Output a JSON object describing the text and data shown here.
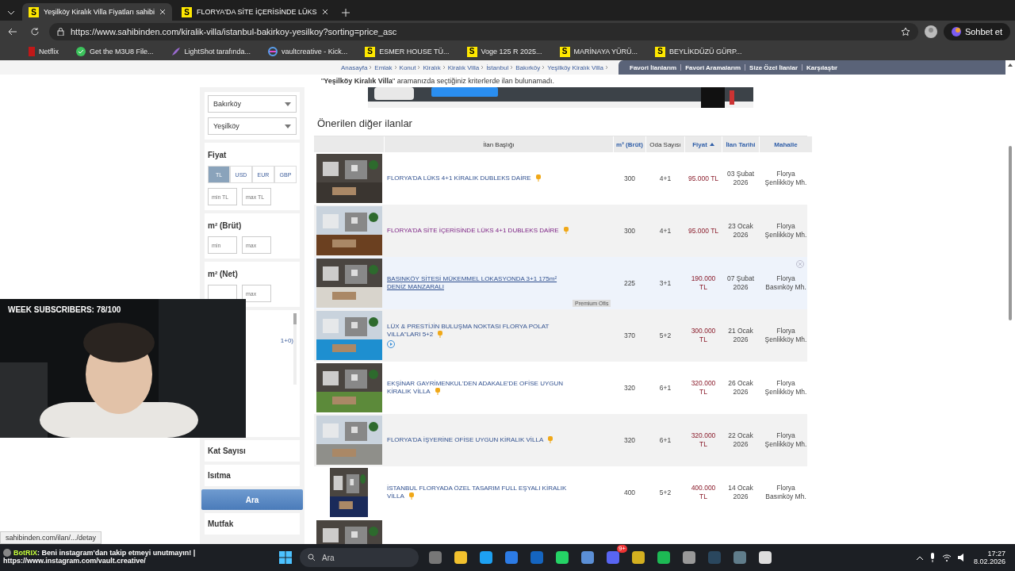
{
  "browser": {
    "tabs": [
      {
        "title": "Yeşilköy Kiralık Villa Fiyatları sahibi",
        "badge": "S",
        "selected": true
      },
      {
        "title": "FLORYA'DA SİTE İÇERİSİNDE LÜKS",
        "badge": "S",
        "selected": false
      }
    ],
    "url": "https://www.sahibinden.com/kiralik-villa/istanbul-bakirkoy-yesilkoy?sorting=price_asc",
    "bookmarks": [
      {
        "kind": "ribbon",
        "label": "Netflix"
      },
      {
        "kind": "check",
        "label": "Get the M3U8 File..."
      },
      {
        "kind": "feather",
        "label": "LightShot tarafında..."
      },
      {
        "kind": "swirl",
        "label": "vaultcreative - Kick..."
      },
      {
        "kind": "badge",
        "badge": "S",
        "label": "ESMER HOUSE TÜ..."
      },
      {
        "kind": "badge",
        "badge": "S",
        "label": "Voge 125 R 2025..."
      },
      {
        "kind": "badge",
        "badge": "S",
        "label": "MARİNAYA YÜRÜ..."
      },
      {
        "kind": "badge",
        "badge": "S",
        "label": "BEYLİKDÜZÜ GÜRP..."
      }
    ],
    "chat_button": "Sohbet et"
  },
  "page": {
    "breadcrumb": [
      "Anasayfa",
      "Emlak",
      "Konut",
      "Kiralık",
      "Kiralık Villa",
      "İstanbul",
      "Bakırköy",
      "Yeşilköy Kiralık Villa"
    ],
    "user_links": [
      "Favori İlanlarım",
      "Favori Aramalarım",
      "Size Özel İlanlar",
      "Karşılaştır"
    ],
    "notice": "\"**Yeşilköy Kiralık Villa**\" aramanızda seçtiğiniz kriterlerde ilan bulunamadı.",
    "sidebar": {
      "selects": [
        "Bakırköy",
        "Yeşilköy"
      ],
      "price": {
        "title": "Fiyat",
        "currencies": [
          {
            "label": "TL",
            "selected": true
          },
          {
            "label": "USD",
            "selected": false
          },
          {
            "label": "EUR",
            "selected": false
          },
          {
            "label": "GBP",
            "selected": false
          }
        ],
        "min_placeholder": "min TL",
        "max_placeholder": "max TL"
      },
      "gross_area": {
        "title": "m² (Brüt)",
        "min_placeholder": "min",
        "max_placeholder": "max"
      },
      "net_area": {
        "title": "m² (Net)",
        "max_placeholder": "max"
      },
      "room_option": "1+0)",
      "sections": [
        "Kat Sayısı",
        "Isıtma"
      ],
      "search_button": "Ara",
      "next_section": "Mutfak"
    },
    "suggested": {
      "title": "Önerilen diğer ilanlar",
      "columns": [
        {
          "label": "İlan Başlığı",
          "kind": "plain",
          "sorted": false
        },
        {
          "label": "m² (Brüt)",
          "kind": "link",
          "sorted": false
        },
        {
          "label": "Oda Sayısı",
          "kind": "plain",
          "sorted": false
        },
        {
          "label": "Fiyat",
          "kind": "link",
          "sorted": true
        },
        {
          "label": "İlan Tarihi",
          "kind": "link",
          "sorted": false
        },
        {
          "label": "Mahalle",
          "kind": "link",
          "sorted": false
        }
      ],
      "rows": [
        {
          "title": "FLORYA'DA LÜKS 4+1 KİRALIK DUBLEKS DAİRE",
          "visited": false,
          "hovered": false,
          "featured": true,
          "video": false,
          "area": "300",
          "rooms": "4+1",
          "price": "95.000 TL",
          "date": "03 Şubat 2026",
          "neighborhood": "Florya Şenlikköy Mh."
        },
        {
          "title": "FLORYA'DA SİTE İÇERİSİNDE LÜKS 4+1 DUBLEKS DAİRE",
          "visited": true,
          "hovered": false,
          "featured": true,
          "video": false,
          "area": "300",
          "rooms": "4+1",
          "price": "95.000 TL",
          "date": "23 Ocak 2026",
          "neighborhood": "Florya Şenlikköy Mh."
        },
        {
          "title": "BASINKÖY SİTESİ MÜKEMMEL LOKASYONDA 3+1 175m² DENİZ MANZARALI",
          "visited": false,
          "hovered": true,
          "featured": false,
          "video": false,
          "premium_label": "Premium Ofis",
          "area": "225",
          "rooms": "3+1",
          "price": "190.000 TL",
          "date": "07 Şubat 2026",
          "neighborhood": "Florya Basınköy Mh."
        },
        {
          "title": "LÜX & PRESTİJİN BULUŞMA NOKTASI FLORYA POLAT VILLA\"LARI 5+2",
          "visited": false,
          "hovered": false,
          "featured": true,
          "video": true,
          "area": "370",
          "rooms": "5+2",
          "price": "300.000 TL",
          "date": "21 Ocak 2026",
          "neighborhood": "Florya Şenlikköy Mh."
        },
        {
          "title": "EKŞİNAR GAYRİMENKUL'DEN ADAKALE'DE OFİSE UYGUN KİRALIK VİLLA",
          "visited": false,
          "hovered": false,
          "featured": true,
          "video": false,
          "area": "320",
          "rooms": "6+1",
          "price": "320.000 TL",
          "date": "26 Ocak 2026",
          "neighborhood": "Florya Şenlikköy Mh."
        },
        {
          "title": "FLORYA'DA İŞYERİNE OFİSE UYGUN KİRALIK VİLLA",
          "visited": false,
          "hovered": false,
          "featured": true,
          "video": false,
          "area": "320",
          "rooms": "6+1",
          "price": "320.000 TL",
          "date": "22 Ocak 2026",
          "neighborhood": "Florya Şenlikköy Mh."
        },
        {
          "title": "İSTANBUL FLORYADA ÖZEL TASARIM FULL EŞYALI KİRALIK VİLLA",
          "visited": false,
          "hovered": false,
          "featured": true,
          "video": false,
          "area": "400",
          "rooms": "5+2",
          "price": "400.000 TL",
          "date": "14 Ocak 2026",
          "neighborhood": "Florya Basınköy Mh."
        }
      ]
    }
  },
  "webcam": {
    "counter": "WEEK SUBSCRIBERS: 78/100"
  },
  "status_link": "sahibinden.com/ilan/.../detay",
  "chat": {
    "user": "BotRIX",
    "message": ": Beni instagram'dan takip etmeyi unutmayın! |",
    "link": "https://www.instagram.com/vault.creative/"
  },
  "taskbar": {
    "search_placeholder": "Ara",
    "notification_badge": "9+",
    "time": "17:27",
    "date": "8.02.2026"
  }
}
